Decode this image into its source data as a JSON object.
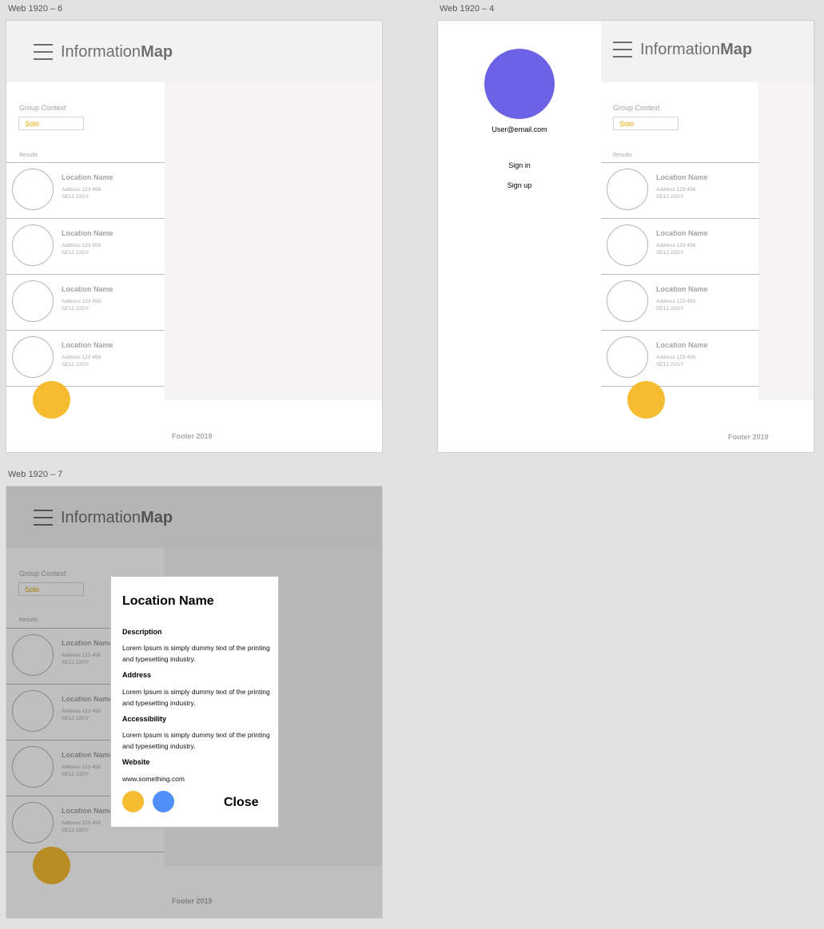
{
  "artboards": {
    "a6": {
      "label": "Web 1920 – 6"
    },
    "a4": {
      "label": "Web 1920 – 4"
    },
    "a7": {
      "label": "Web 1920 – 7"
    }
  },
  "brand": {
    "light": "Information",
    "bold": "Map"
  },
  "group_context": {
    "label": "Group Context",
    "value": "Solo"
  },
  "results_label": "Results",
  "results": [
    {
      "name": "Location Name",
      "address1": "Address 123 456",
      "address2": "SE12 22GY"
    },
    {
      "name": "Location Name",
      "address1": "Address 123 456",
      "address2": "SE12 22GY"
    },
    {
      "name": "Location Name",
      "address1": "Address 123 456",
      "address2": "SE12 22GY"
    },
    {
      "name": "Location Name",
      "address1": "Address 123 456",
      "address2": "SE12 22GY"
    }
  ],
  "footer": "Footer 2019",
  "side_menu": {
    "email": "User@email.com",
    "sign_in": "Sign in",
    "sign_up": "Sign up"
  },
  "modal": {
    "title": "Location Name",
    "description_heading": "Description",
    "description_text": "Lorem Ipsum is simply dummy text of the printing and typesetting industry.",
    "address_heading": "Address",
    "address_text": "Lorem Ipsum is simply dummy text of the printing and typesetting industry.",
    "accessibility_heading": "Accessibility",
    "accessibility_text": "Lorem Ipsum is simply dummy text of the printing and typesetting industry.",
    "website_heading": "Website",
    "website_text": "www.something.com",
    "close_label": "Close"
  },
  "colors": {
    "accent_yellow": "#f6bc30",
    "accent_blue": "#4f8ff7",
    "avatar_purple": "#6b62e6",
    "select_text": "#e3a800"
  },
  "icons": [
    "hamburger-menu-icon",
    "user-avatar",
    "floating-action-button"
  ]
}
